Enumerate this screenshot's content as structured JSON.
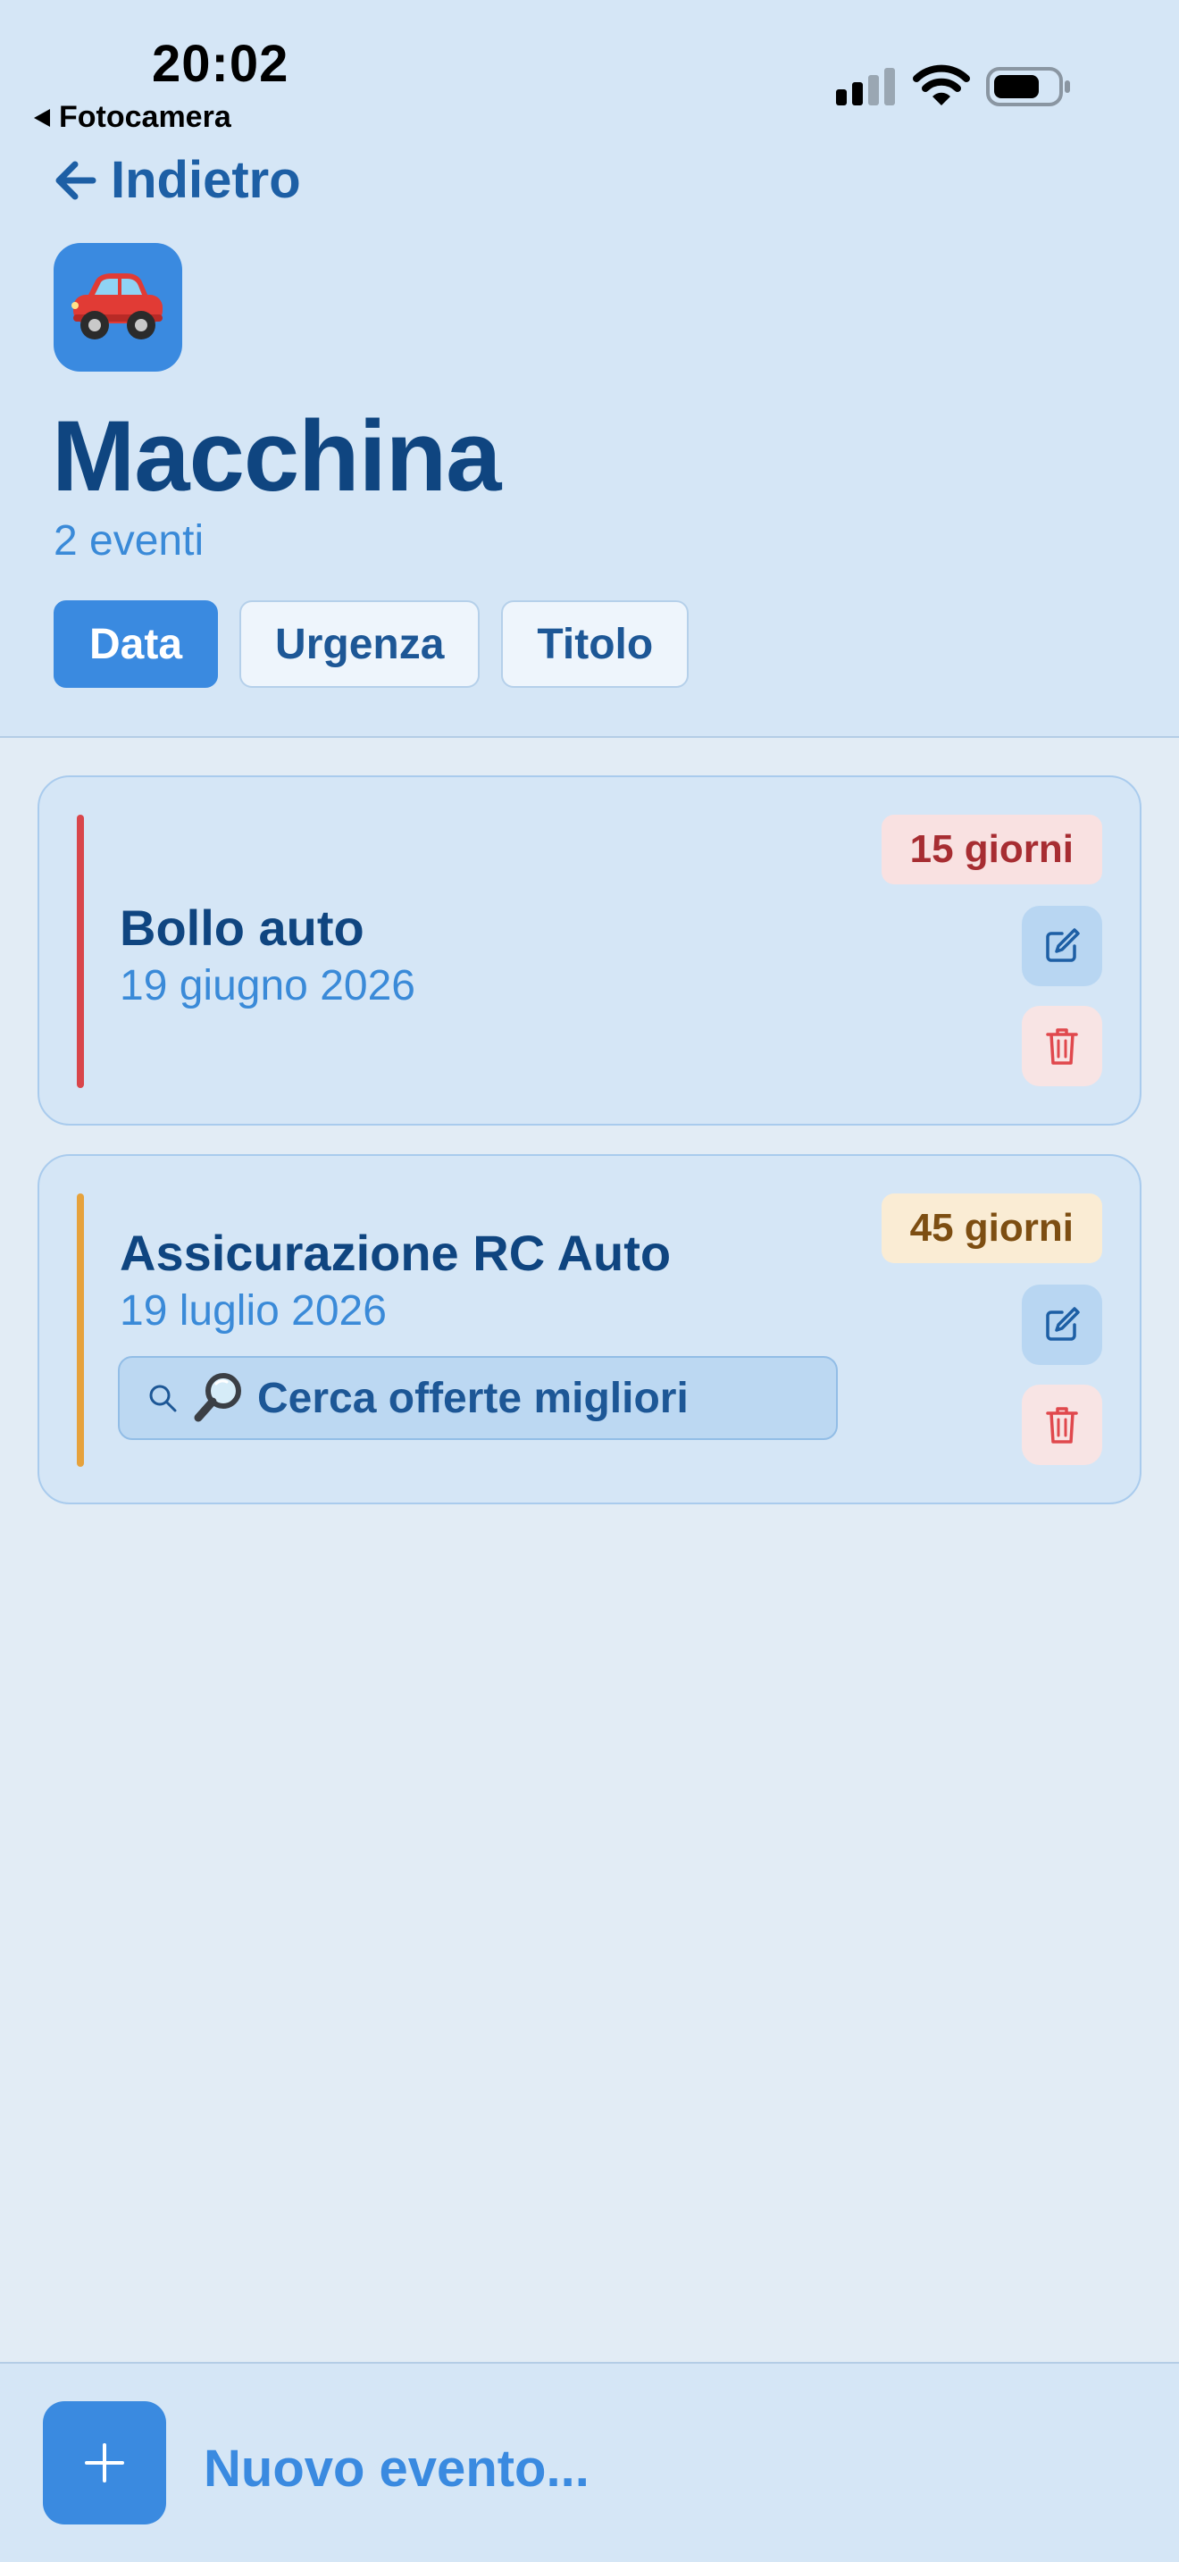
{
  "status_bar": {
    "time": "20:02",
    "back_app": "Fotocamera"
  },
  "nav": {
    "back_label": "Indietro"
  },
  "category": {
    "emoji": "🚗",
    "title": "Macchina",
    "subtitle": "2 eventi"
  },
  "sort_tabs": [
    {
      "label": "Data",
      "active": true
    },
    {
      "label": "Urgenza",
      "active": false
    },
    {
      "label": "Titolo",
      "active": false
    }
  ],
  "events": [
    {
      "title": "Bollo auto",
      "date": "19 giugno 2026",
      "badge": "15 giorni",
      "accent_color": "#d9464b",
      "badge_bg": "#f9e1e1",
      "badge_color": "#a72d32"
    },
    {
      "title": "Assicurazione RC Auto",
      "date": "19 luglio 2026",
      "badge": "45 giorni",
      "accent_color": "#e6a23c",
      "badge_bg": "#faecd4",
      "badge_color": "#7d4e12",
      "offer_button": {
        "emoji": "🔎",
        "label": "Cerca offerte migliori"
      }
    }
  ],
  "bottom": {
    "new_event_label": "Nuovo evento..."
  },
  "colors": {
    "accent": "#3a8ae0",
    "title": "#0f4580",
    "date": "#3a8ad8",
    "delete": "#e0484d"
  },
  "icons": [
    "arrow-left-icon",
    "car-icon",
    "edit-icon",
    "trash-icon",
    "search-icon",
    "magnifier-emoji-icon",
    "plus-icon",
    "signal-icon",
    "wifi-icon",
    "battery-icon"
  ]
}
